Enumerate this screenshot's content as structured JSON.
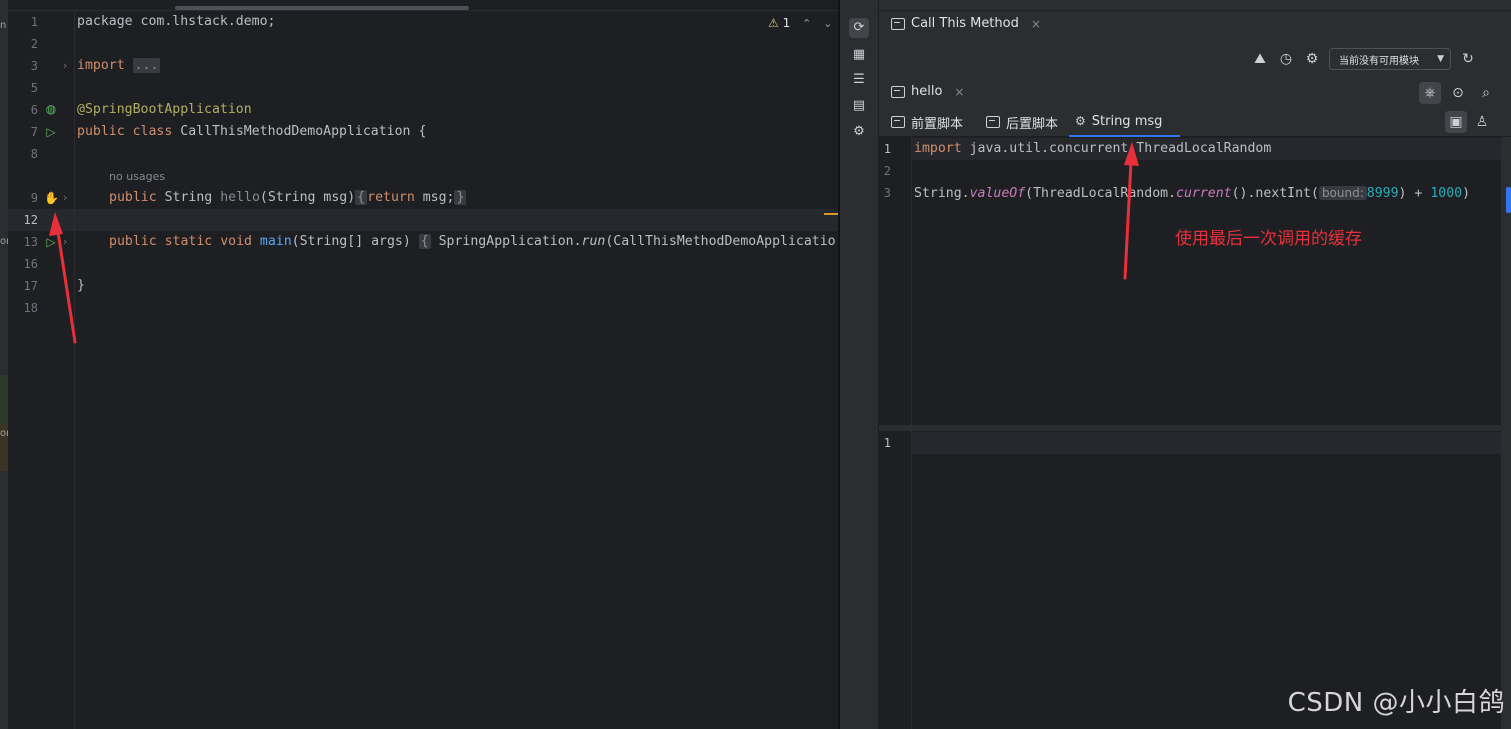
{
  "left_strip": {
    "fragments": [
      "n",
      "or",
      "or"
    ]
  },
  "editor": {
    "warnings": {
      "count": "1",
      "prev": "⌃",
      "next": "⌄"
    },
    "lines": [
      {
        "no": "1",
        "code": "package com.lhstack.demo;"
      },
      {
        "no": "2"
      },
      {
        "no": "3",
        "kw": "import",
        "folded": "..."
      },
      {
        "no": "5"
      },
      {
        "no": "6",
        "annotation": "@SpringBootApplication"
      },
      {
        "no": "7",
        "kw1": "public",
        "kw2": "class",
        "name": "CallThisMethodDemoApplication",
        "rest": " {"
      },
      {
        "no": "8"
      },
      {
        "no": "9",
        "kw1": "public",
        "type": "String",
        "name": "hello",
        "params": "(String msg)",
        "lb": "{",
        "kw2": "return",
        "body": " msg;",
        "rb": "}"
      },
      {
        "no": "12"
      },
      {
        "no": "13",
        "kw1": "public",
        "kw2": "static",
        "kw3": "void",
        "name": "main",
        "params": "(String[] args)",
        "lb": "{",
        "body": " SpringApplication.",
        "call": "run",
        "rest": "(CallThisMethodDemoApplicatio"
      },
      {
        "no": "16"
      },
      {
        "no": "17",
        "code": "}"
      },
      {
        "no": "18"
      }
    ],
    "usage_hint": "no usages"
  },
  "panel": {
    "tool_tab": {
      "title": "Call This Method",
      "close": "×"
    },
    "module_select": {
      "value": "当前没有可用模块",
      "arrow": "▼"
    },
    "method_tab": {
      "title": "hello",
      "close": "×"
    },
    "subtabs": [
      {
        "label": "前置脚本"
      },
      {
        "label": "后置脚本"
      },
      {
        "label": "String msg"
      }
    ],
    "script": {
      "line1": {
        "no": "1",
        "kw": "import",
        "rest": " java.util.concurrent.ThreadLocalRandom"
      },
      "line2": {
        "no": "2"
      },
      "line3": {
        "no": "3",
        "a": "String.",
        "fn1": "valueOf",
        "b": "(ThreadLocalRandom.",
        "fn2": "current",
        "c": "().nextInt(",
        "hint": "bound:",
        "n1": "8999",
        "d": ") + ",
        "n2": "1000",
        "e": ")"
      }
    },
    "result": {
      "line1": {
        "no": "1"
      }
    },
    "annotation": "使用最后一次调用的缓存"
  },
  "watermark": "CSDN @小小白鸽",
  "colors": {
    "accent": "#3574f0",
    "arrow_red": "#e8303a",
    "keyword": "#cf8e6d",
    "annotation": "#b3ae60"
  }
}
